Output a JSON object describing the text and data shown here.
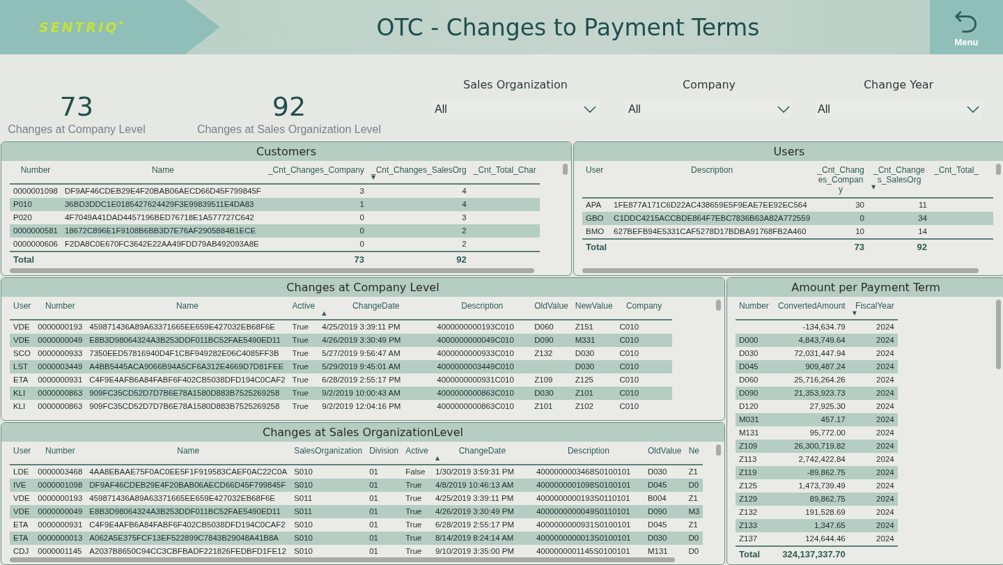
{
  "header": {
    "logo": {
      "text": "SENTRIQ",
      "mark": "*"
    },
    "title": "OTC - Changes to Payment Terms",
    "menu_button": {
      "label": "Menu"
    }
  },
  "kpis": [
    {
      "value": "73",
      "label": "Changes at Company Level"
    },
    {
      "value": "92",
      "label": "Changes at Sales Organization Level"
    }
  ],
  "filters": [
    {
      "label": "Sales Organization",
      "value": "All"
    },
    {
      "label": "Company",
      "value": "All"
    },
    {
      "label": "Change Year",
      "value": "All"
    }
  ],
  "customers": {
    "title": "Customers",
    "total_label": "Total",
    "columns": [
      {
        "label": "Number"
      },
      {
        "label": "Name"
      },
      {
        "label": "_Cnt_Changes_Company",
        "numeric": true,
        "total": "73"
      },
      {
        "label": "_Cnt_Changes_SalesOrg",
        "numeric": true,
        "sort_arrow": "▼",
        "total": "92"
      },
      {
        "label": "_Cnt_Total_Char"
      }
    ],
    "rows": [
      [
        "0000001098",
        "DF9AF46CDEB29E4F20BAB06AECD66D45F799845F",
        "3",
        "4",
        null
      ],
      [
        "P010",
        "36BD3DDC1E0185427624429F3E99839511E4DA83",
        "1",
        "4",
        null
      ],
      [
        "P020",
        "4F7049A41DAD4457196BED76718E1A577727C642",
        "0",
        "3",
        null
      ],
      [
        "0000000581",
        "18672C896E1F9108B6BB3D7E76AF2905884B1ECE",
        "0",
        "2",
        null
      ],
      [
        "0000000606",
        "F2DA8C0E670FC3642E22AA49FDD79AB492093A8E",
        "0",
        "2",
        null
      ]
    ]
  },
  "users": {
    "title": "Users",
    "total_label": "Total",
    "columns": [
      {
        "label": "User"
      },
      {
        "label": "Description"
      },
      {
        "label": "_Cnt_Changes_Company",
        "numeric": true,
        "total": "73"
      },
      {
        "label": "_Cnt_Changes_SalesOrg",
        "numeric": true,
        "sort_arrow": "▼",
        "total": "92"
      },
      {
        "label": "_Cnt_Total_"
      }
    ],
    "rows": [
      [
        "APA",
        "1FE877A171C6D22AC438659E5F9EAE7EE92EC564",
        "30",
        "11",
        null
      ],
      [
        "GBO",
        "C1DDC4215ACCBDE864F7EBC7836B63A82A772559",
        "0",
        "34",
        null
      ],
      [
        "BMO",
        "627BEFB94E5331CAF5278D17BDBA91768FB2A460",
        "10",
        "14",
        null
      ]
    ]
  },
  "company_changes": {
    "title": "Changes at Company Level",
    "columns": [
      {
        "label": "User"
      },
      {
        "label": "Number"
      },
      {
        "label": "Name"
      },
      {
        "label": "Active"
      },
      {
        "label": "ChangeDate",
        "sort_arrow": "▲"
      },
      {
        "label": "Description"
      },
      {
        "label": "OldValue"
      },
      {
        "label": "NewValue"
      },
      {
        "label": "Company"
      }
    ],
    "rows": [
      [
        "VDE",
        "0000000193",
        "459871436A89A63371665EE659E427032EB68F6E",
        "True",
        "4/25/2019 3:39:11 PM",
        "4000000000193C010",
        "D060",
        "Z151",
        "C010"
      ],
      [
        "VDE",
        "0000000049",
        "E8B3D98064324A3B253DDF011BC52FAE5490ED11",
        "True",
        "4/26/2019 3:30:49 PM",
        "4000000000049C010",
        "D090",
        "M331",
        "C010"
      ],
      [
        "SCO",
        "0000000933",
        "7350EED57816940D4F1CBF949282E06C4085FF3B",
        "True",
        "5/27/2019 9:56:47 AM",
        "4000000000933C010",
        "Z132",
        "D030",
        "C010"
      ],
      [
        "LST",
        "0000003449",
        "A4BB5445ACA9066B94A5CF6A312E4669D7D81FEE",
        "True",
        "5/29/2019 9:45:01 AM",
        "4000000003449C010",
        null,
        "D030",
        "C010"
      ],
      [
        "ETA",
        "0000000931",
        "C4F9E4AFB6A84FABF6F402CB5038DFD194C0CAF2",
        "True",
        "6/28/2019 2:55:17 PM",
        "4000000000931C010",
        "Z109",
        "Z125",
        "C010"
      ],
      [
        "KLI",
        "0000000863",
        "909FC35CD52D7D7B6E78A1580D883B7525269258",
        "True",
        "9/2/2019 10:00:43 AM",
        "4000000000863C010",
        "D030",
        "Z101",
        "C010"
      ],
      [
        "KLI",
        "0000000863",
        "909FC35CD52D7D7B6E78A1580D883B7525269258",
        "True",
        "9/2/2019 12:04:16 PM",
        "4000000000863C010",
        "Z101",
        "Z102",
        "C010"
      ]
    ]
  },
  "salesorg_changes": {
    "title": "Changes at Sales OrganizationLevel",
    "columns": [
      {
        "label": "User"
      },
      {
        "label": "Number"
      },
      {
        "label": "Name"
      },
      {
        "label": "SalesOrganization"
      },
      {
        "label": "Division"
      },
      {
        "label": "Active"
      },
      {
        "label": "ChangeDate",
        "sort_arrow": "▲"
      },
      {
        "label": "Description"
      },
      {
        "label": "OldValue"
      },
      {
        "label": "Ne"
      }
    ],
    "rows": [
      [
        "LDE",
        "0000003468",
        "4AA8EBAAE75F0AC0EE5F1F919583CAEF0AC22C0A",
        "S010",
        "01",
        "False",
        "1/30/2019 3:59:31 PM",
        "4000000003468S0100101",
        "D030",
        "Z1"
      ],
      [
        "IVE",
        "0000001098",
        "DF9AF46CDEB29E4F20BAB06AECD66D45F799845F",
        "S010",
        "01",
        "True",
        "4/8/2019 10:46:13 AM",
        "4000000001098S0100101",
        "D045",
        "D0"
      ],
      [
        "VDE",
        "0000000193",
        "459871436A89A63371665EE659E427032EB68F6E",
        "S011",
        "01",
        "True",
        "4/25/2019 3:39:11 PM",
        "4000000000193S0110101",
        "B004",
        "Z1"
      ],
      [
        "VDE",
        "0000000049",
        "E8B3D98064324A3B253DDF011BC52FAE5490ED11",
        "S011",
        "01",
        "True",
        "4/26/2019 3:30:49 PM",
        "4000000000049S0110101",
        "D090",
        "M3"
      ],
      [
        "ETA",
        "0000000931",
        "C4F9E4AFB6A84FABF6F402CB5038DFD194C0CAF2",
        "S010",
        "01",
        "True",
        "6/28/2019 2:55:17 PM",
        "4000000000931S0100101",
        "D045",
        "Z1"
      ],
      [
        "ETA",
        "0000000013",
        "A062A5E375FCF13EF522899C7843B29048A41B8A",
        "S010",
        "01",
        "True",
        "8/14/2019 8:24:14 AM",
        "4000000000013S0100101",
        "D030",
        "D0"
      ],
      [
        "CDJ",
        "0000001145",
        "A2037B8650C94CC3CBFBADF221826FEDBFD1FE12",
        "S010",
        "01",
        "True",
        "9/10/2019 3:35:00 PM",
        "4000000001145S0100101",
        "M131",
        "D0"
      ]
    ]
  },
  "amount_per_term": {
    "title": "Amount per Payment Term",
    "total_label": "Total",
    "columns": [
      {
        "label": "Number"
      },
      {
        "label": "ConvertedAmount",
        "numeric": true,
        "total": "324,137,337.70"
      },
      {
        "label": "FiscalYear",
        "numeric": true,
        "sort_arrow": "▼"
      }
    ],
    "rows": [
      [
        null,
        "-134,634.79",
        "2024"
      ],
      [
        "D000",
        "4,843,749.64",
        "2024"
      ],
      [
        "D030",
        "72,031,447.94",
        "2024"
      ],
      [
        "D045",
        "909,487.24",
        "2024"
      ],
      [
        "D060",
        "25,716,264.26",
        "2024"
      ],
      [
        "D090",
        "21,353,923.73",
        "2024"
      ],
      [
        "D120",
        "27,925.30",
        "2024"
      ],
      [
        "M031",
        "457.17",
        "2024"
      ],
      [
        "M131",
        "95,772.00",
        "2024"
      ],
      [
        "Z109",
        "26,300,719.82",
        "2024"
      ],
      [
        "Z113",
        "2,742,422.84",
        "2024"
      ],
      [
        "Z119",
        "-89,862.75",
        "2024"
      ],
      [
        "Z125",
        "1,473,739.49",
        "2024"
      ],
      [
        "Z129",
        "89,862.75",
        "2024"
      ],
      [
        "Z132",
        "191,528.69",
        "2024"
      ],
      [
        "Z133",
        "1,347.65",
        "2024"
      ],
      [
        "Z137",
        "124,644.46",
        "2024"
      ]
    ]
  }
}
